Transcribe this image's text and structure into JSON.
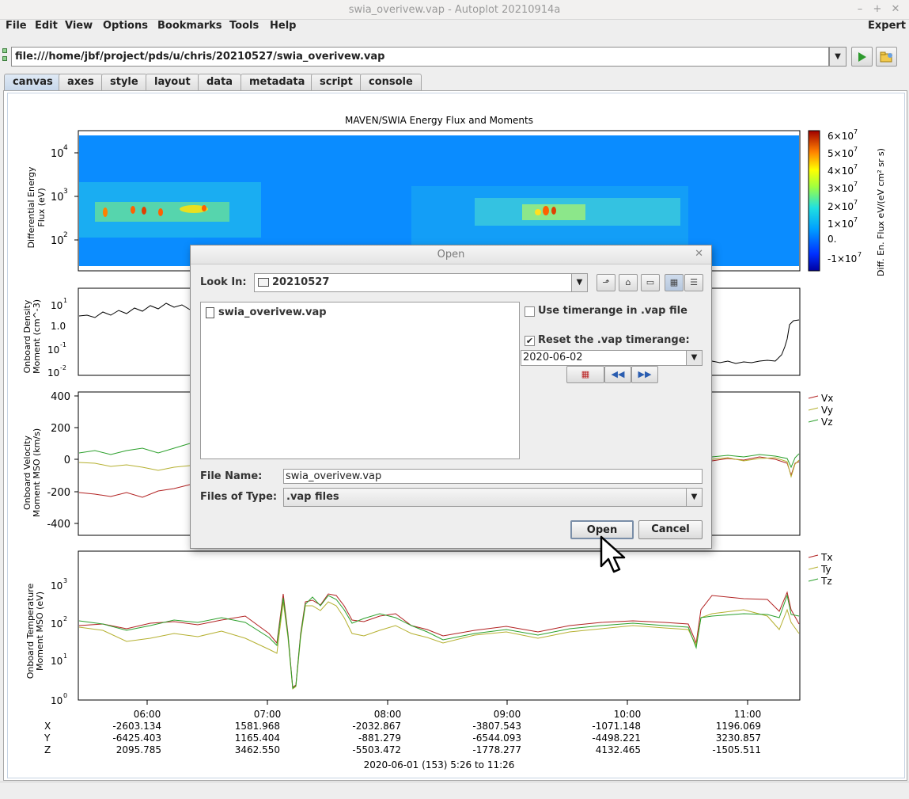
{
  "window": {
    "title": "swia_overivew.vap - Autoplot 20210914a"
  },
  "menu": {
    "items": [
      "File",
      "Edit",
      "View",
      "Options",
      "Bookmarks",
      "Tools",
      "Help"
    ],
    "expert": "Expert"
  },
  "url": {
    "value": "file:///home/jbf/project/pds/u/chris/20210527/swia_overivew.vap"
  },
  "tabs": [
    "canvas",
    "axes",
    "style",
    "layout",
    "data",
    "metadata",
    "script",
    "console"
  ],
  "plot": {
    "title": "MAVEN/SWIA Energy Flux and Moments",
    "panel1": {
      "ylabel1": "Differential Energy",
      "ylabel2": "Flux (eV)",
      "ticks": [
        "10",
        "10",
        "10"
      ],
      "exps": [
        "4",
        "3",
        "2"
      ]
    },
    "colorbar": {
      "label": "Diff. En. Flux  eV/(eV cm² sr s)",
      "ticks": [
        "6×10",
        "5×10",
        "4×10",
        "3×10",
        "2×10",
        "1×10",
        "0.",
        "-1×10"
      ],
      "exp": "7"
    },
    "panel2": {
      "ylabel1": "Onboard Density",
      "ylabel2": "Moment (cm^-3)",
      "ticks": [
        "10",
        "10",
        "10",
        "10"
      ],
      "exps": [
        "1",
        "0",
        "-1",
        "-2"
      ],
      "tick_1": "1.0"
    },
    "panel3": {
      "ylabel1": "Onboard Velocity",
      "ylabel2": "Moment MSO (km/s)",
      "ticks": [
        "400",
        "200",
        "0",
        "-200",
        "-400"
      ],
      "legend": [
        "Vx",
        "Vy",
        "Vz"
      ]
    },
    "panel4": {
      "ylabel1": "Onboard Temperature",
      "ylabel2": "Moment MSO (eV)",
      "ticks": [
        "10",
        "10",
        "10",
        "10"
      ],
      "exps": [
        "3",
        "2",
        "1"
      ],
      "tick0": "10",
      "tick0exp": "0",
      "legend": [
        "Tx",
        "Ty",
        "Tz"
      ]
    },
    "xaxis": {
      "ticks": [
        "06:00",
        "07:00",
        "08:00",
        "09:00",
        "10:00",
        "11:00"
      ],
      "rows": [
        {
          "label": "X",
          "values": [
            "-2603.134",
            "1581.968",
            "-2032.867",
            "-3807.543",
            "-1071.148",
            "1196.069"
          ]
        },
        {
          "label": "Y",
          "values": [
            "-6425.403",
            "1165.404",
            "-881.279",
            "-6544.093",
            "-4498.221",
            "3230.857"
          ]
        },
        {
          "label": "Z",
          "values": [
            "2095.785",
            "3462.550",
            "-5503.472",
            "-1778.277",
            "4132.465",
            "-1505.511"
          ]
        }
      ],
      "range": "2020-06-01 (153) 5:26 to 11:26"
    },
    "colors": {
      "x": "#b22222",
      "y": "#b5b030",
      "z": "#2ca02c"
    }
  },
  "dialog": {
    "title": "Open",
    "look_in_label": "Look In:",
    "look_in_value": "20210527",
    "files": [
      "swia_overivew.vap"
    ],
    "use_timerange_label": "Use timerange in .vap file",
    "use_timerange_checked": false,
    "reset_label": "Reset the .vap timerange:",
    "reset_checked": true,
    "timerange_value": "2020-06-02",
    "file_name_label": "File Name:",
    "file_name_value": "swia_overivew.vap",
    "file_type_label": "Files of Type:",
    "file_type_value": ".vap files",
    "open_button": "Open",
    "cancel_button": "Cancel"
  }
}
